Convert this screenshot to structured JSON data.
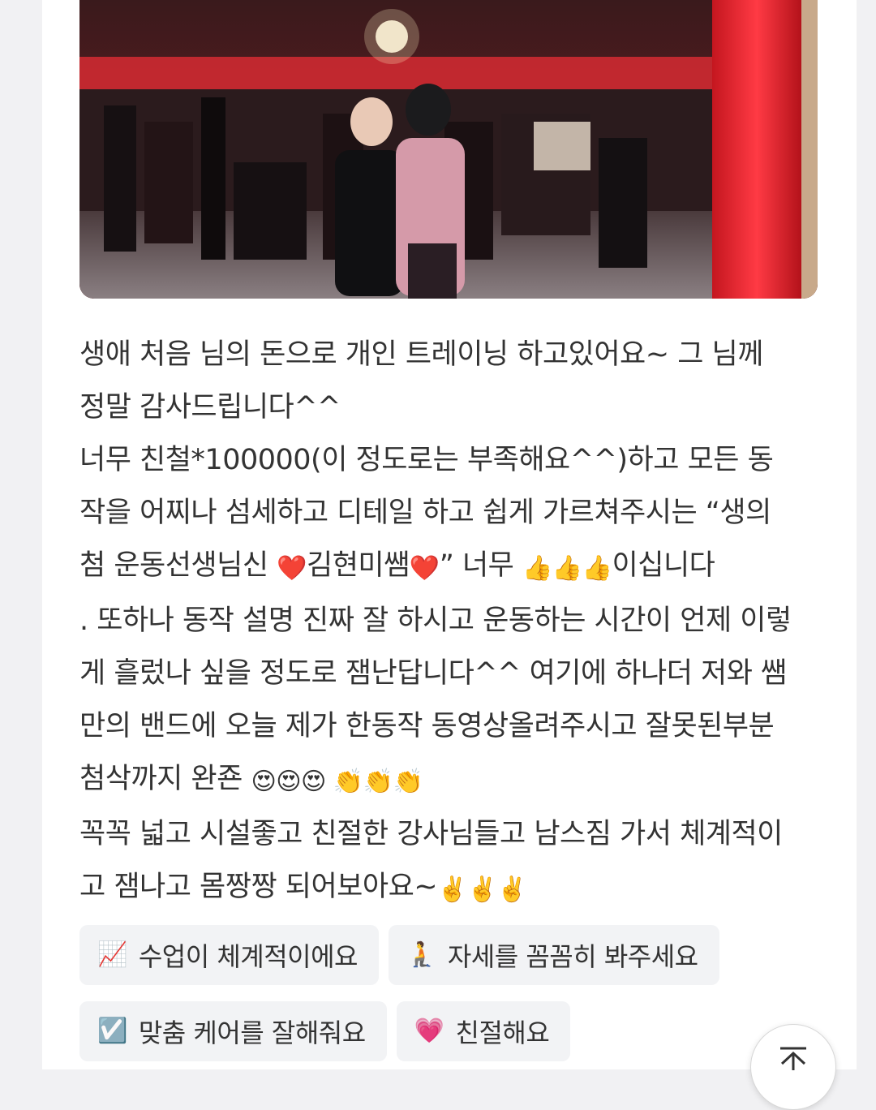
{
  "photo": {
    "alt_subject": "two-women-in-gym-mirror-selfie"
  },
  "review": {
    "line1": "생애 처음 님의 돈으로 개인 트레이닝 하고있어요~ 그 님께",
    "line2": "정말 감사드립니다^^",
    "line3": "너무 친철*100000(이 정도로는 부족해요^^)하고 모든 동",
    "line4": "작을 어찌나 섬세하고 디테일 하고 쉽게 가르쳐주시는 “생의",
    "line5_a": "첨 운동선생님신 ",
    "line5_heart1": "❤️",
    "line5_name": "김현미쌤",
    "line5_heart2": "❤️",
    "line5_b": "” 너무 ",
    "line5_thumbs": "👍👍👍",
    "line5_c": "이십니다",
    "line6": ". 또하나 동작 설명 진짜 잘 하시고 운동하는 시간이 언제 이렇",
    "line7": "게 흘렀나 싶을 정도로 잼난답니다^^ 여기에 하나더 저와 쌤",
    "line8": "만의 밴드에 오늘 제가 한동작 동영상올려주시고 잘못된부분",
    "line9_a": "첨삭까지 완죤 ",
    "line9_eyes": "😍😍😍",
    "line9_clap": " 👏👏👏",
    "line10": "꼭꼭 넓고 시설좋고 친절한 강사님들고 남스짐 가서 체계적이",
    "line11_a": "고 잼나고 몸짱짱 되어보아요~",
    "line11_peace": "✌️✌️✌️"
  },
  "tags": [
    {
      "icon": "📈",
      "label": "수업이 체계적이에요"
    },
    {
      "icon": "🧎",
      "label": "자세를 꼼꼼히 봐주세요"
    },
    {
      "icon": "☑️",
      "label": "맞춤 케어를 잘해줘요"
    },
    {
      "icon": "💗",
      "label": "친절해요"
    }
  ],
  "scroll_top": {
    "icon": "scroll-to-top-icon"
  },
  "colors": {
    "background": "#f1f1f3",
    "card": "#ffffff",
    "text": "#333333",
    "tag_background": "#f2f3f5",
    "photo_accent_red": "#e0262f"
  }
}
